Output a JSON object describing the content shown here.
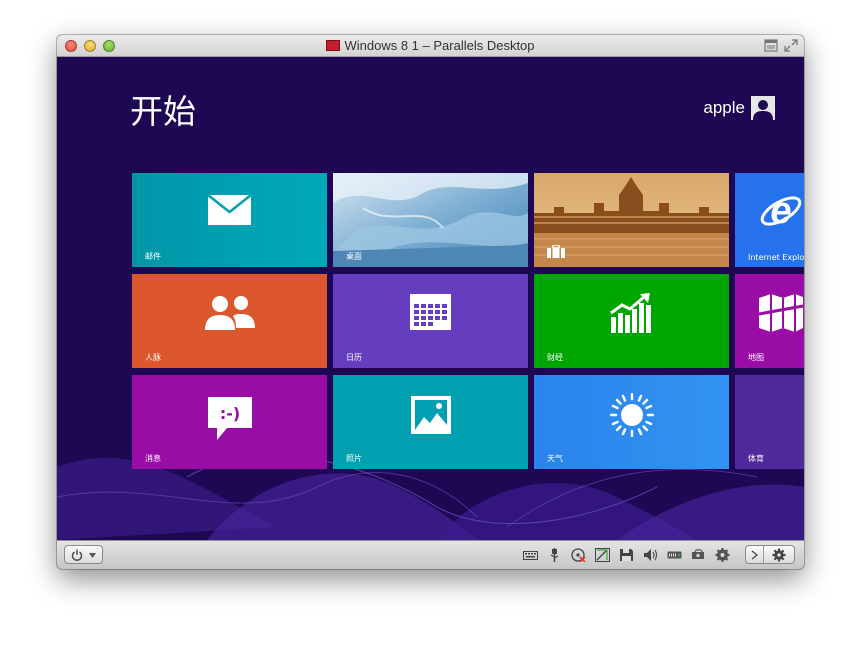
{
  "window": {
    "title": "Windows 8 1 – Parallels Desktop"
  },
  "start_screen": {
    "title": "开始",
    "user_name": "apple"
  },
  "tiles": [
    {
      "label": "邮件",
      "color": "#00a0b1",
      "icon": "mail-icon"
    },
    {
      "label": "桌面",
      "color": "#7fb0d0",
      "icon": "none"
    },
    {
      "label": "",
      "color": "#d28a4a",
      "icon": "briefcase-icon"
    },
    {
      "label": "Internet Explorer",
      "color": "#2672ec",
      "icon": "internet-explorer-icon"
    },
    {
      "label": "人脉",
      "color": "#dc572e",
      "icon": "people-icon"
    },
    {
      "label": "日历",
      "color": "#643ebf",
      "icon": "calendar-icon"
    },
    {
      "label": "财经",
      "color": "#00a600",
      "icon": "finance-chart-icon"
    },
    {
      "label": "地图",
      "color": "#8c0095",
      "icon": "map-icon"
    },
    {
      "label": "消息",
      "color": "#9a0ca6",
      "icon": "message-smiley-icon"
    },
    {
      "label": "照片",
      "color": "#00a0b1",
      "icon": "photo-icon"
    },
    {
      "label": "天气",
      "color": "#2e8def",
      "icon": "sun-icon"
    },
    {
      "label": "体育",
      "color": "#4e2a9b",
      "icon": "none"
    }
  ],
  "message_icon_text": ":-)",
  "statusbar": {
    "devices": [
      "keyboard-icon",
      "usb-icon",
      "cd-disabled-icon",
      "network-icon",
      "floppy-icon",
      "sound-icon",
      "hard-disk-icon",
      "shared-folder-icon",
      "settings-gear-icon"
    ]
  }
}
